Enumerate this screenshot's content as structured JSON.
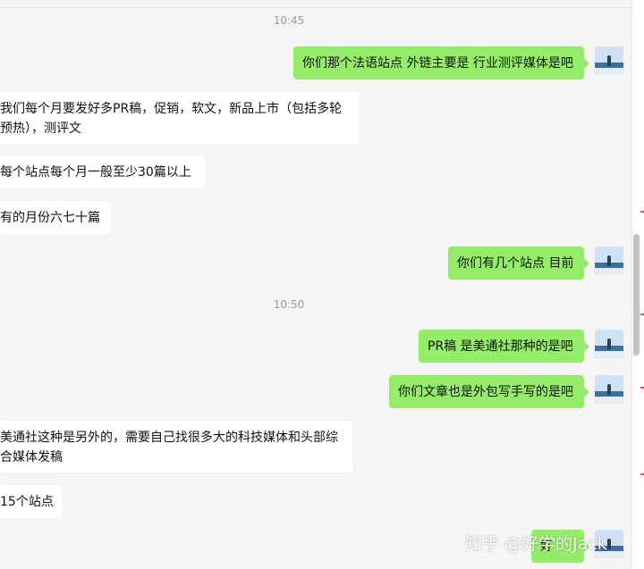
{
  "chat": {
    "time_1": "10:45",
    "time_2": "10:50",
    "messages": [
      {
        "dir": "sent",
        "text": "你们那个法语站点 外链主要是 行业测评媒体是吧"
      },
      {
        "dir": "recv",
        "text": "我们每个月要发好多PR稿，促销，软文，新品上市（包括多轮预热），测评文"
      },
      {
        "dir": "recv",
        "text": "每个站点每个月一般至少30篇以上"
      },
      {
        "dir": "recv",
        "text": "有的月份六七十篇"
      },
      {
        "dir": "sent",
        "text": "你们有几个站点 目前"
      },
      {
        "dir": "sent",
        "text": "PR稿 是美通社那种的是吧"
      },
      {
        "dir": "sent",
        "text": "你们文章也是外包写手写的是吧"
      },
      {
        "dir": "recv",
        "text": "美通社这种是另外的，需要自己找很多大的科技媒体和头部综合媒体发稿"
      },
      {
        "dir": "recv",
        "text": "15个站点"
      },
      {
        "dir": "sent",
        "text": "好"
      }
    ]
  },
  "watermark": "知乎 @好学的Jack",
  "colors": {
    "sent_bubble": "#95ec69",
    "recv_bubble": "#ffffff",
    "background": "#f5f5f5"
  }
}
